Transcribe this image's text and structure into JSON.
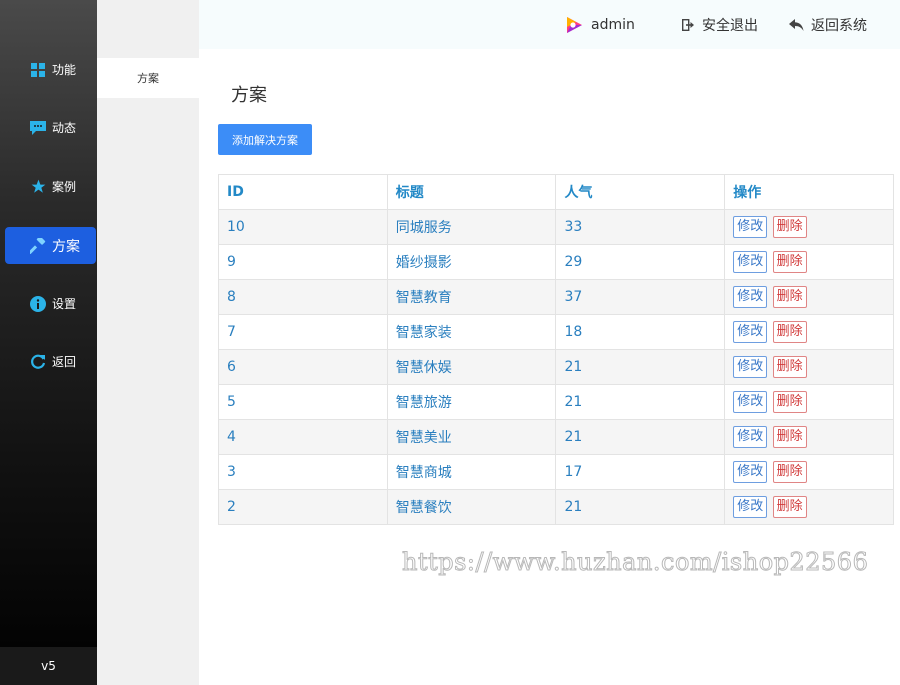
{
  "sidebar": {
    "items": [
      {
        "label": "功能",
        "icon": "grid-icon"
      },
      {
        "label": "动态",
        "icon": "chat-icon"
      },
      {
        "label": "案例",
        "icon": "star-icon"
      },
      {
        "label": "方案",
        "icon": "hammer-icon"
      },
      {
        "label": "设置",
        "icon": "info-icon"
      },
      {
        "label": "返回",
        "icon": "refresh-icon"
      }
    ],
    "active_index": 3,
    "version": "v5"
  },
  "subnav": {
    "active_item": "方案"
  },
  "topbar": {
    "user": "admin",
    "logout": "安全退出",
    "back": "返回系统"
  },
  "main": {
    "title": "方案",
    "add_button": "添加解决方案",
    "table": {
      "headers": [
        "ID",
        "标题",
        "人气",
        "操作"
      ],
      "edit_label": "修改",
      "delete_label": "删除",
      "rows": [
        {
          "id": "10",
          "title": "同城服务",
          "popularity": "33"
        },
        {
          "id": "9",
          "title": "婚纱摄影",
          "popularity": "29"
        },
        {
          "id": "8",
          "title": "智慧教育",
          "popularity": "37"
        },
        {
          "id": "7",
          "title": "智慧家装",
          "popularity": "18"
        },
        {
          "id": "6",
          "title": "智慧休娱",
          "popularity": "21"
        },
        {
          "id": "5",
          "title": "智慧旅游",
          "popularity": "21"
        },
        {
          "id": "4",
          "title": "智慧美业",
          "popularity": "21"
        },
        {
          "id": "3",
          "title": "智慧商城",
          "popularity": "17"
        },
        {
          "id": "2",
          "title": "智慧餐饮",
          "popularity": "21"
        }
      ]
    }
  },
  "watermark": "https://www.huzhan.com/ishop22566",
  "colors": {
    "accent": "#1d5fe0",
    "button": "#3c8df7",
    "header_text": "#2389c7",
    "cell_text": "#2a7fbf",
    "delete": "#d13a3a"
  }
}
